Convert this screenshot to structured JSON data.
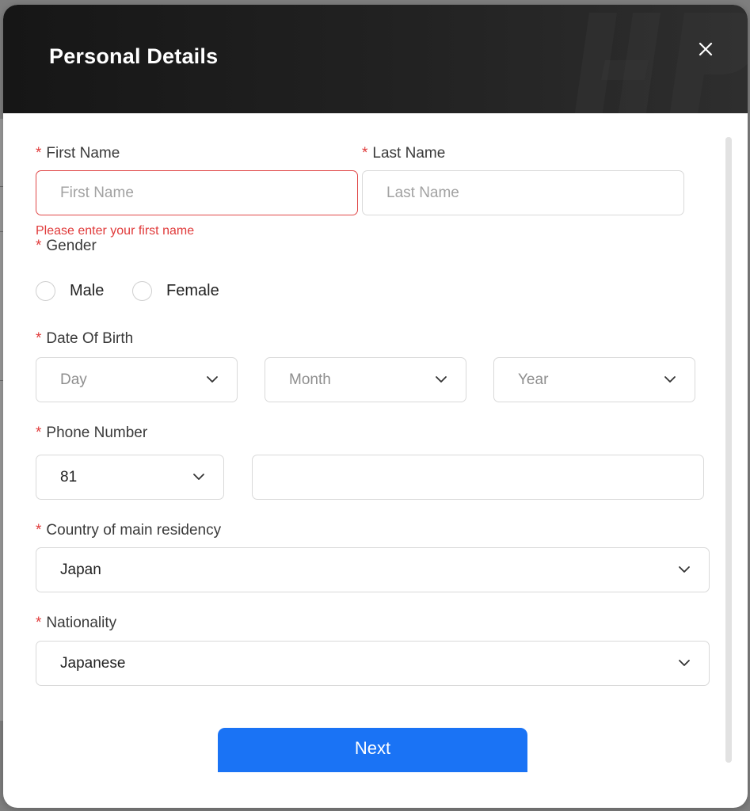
{
  "modal": {
    "title": "Personal Details",
    "close_icon": "close-icon"
  },
  "form": {
    "first_name": {
      "label": "First Name",
      "required_mark": "*",
      "placeholder": "First Name",
      "value": "",
      "error": "Please enter your first name"
    },
    "last_name": {
      "label": "Last Name",
      "required_mark": "*",
      "placeholder": "Last Name",
      "value": ""
    },
    "gender": {
      "label": "Gender",
      "required_mark": "*",
      "options": [
        "Male",
        "Female"
      ],
      "selected": null
    },
    "date_of_birth": {
      "label": "Date Of Birth",
      "required_mark": "*",
      "day_placeholder": "Day",
      "month_placeholder": "Month",
      "year_placeholder": "Year"
    },
    "phone": {
      "label": "Phone Number",
      "required_mark": "*",
      "country_code": "81",
      "number": ""
    },
    "country": {
      "label": "Country of main residency",
      "required_mark": "*",
      "value": "Japan"
    },
    "nationality": {
      "label": "Nationality",
      "required_mark": "*",
      "value": "Japanese"
    }
  },
  "actions": {
    "next_label": "Next"
  },
  "colors": {
    "primary": "#1a73f5",
    "error": "#e03a3a",
    "header_bg": "#1c1c1c"
  }
}
